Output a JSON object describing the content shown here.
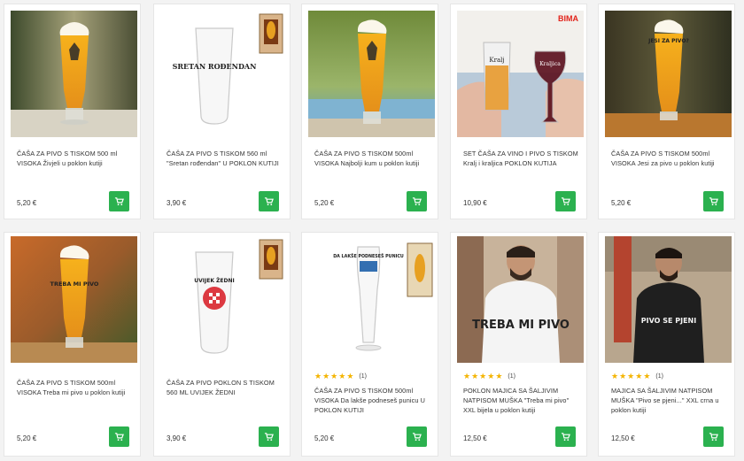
{
  "colors": {
    "accent": "#2bb14f",
    "star": "#f4b400",
    "price": "#333333"
  },
  "products": [
    {
      "title": "ČAŠA ZA PIVO S TISKOM 500 ml VISOKA Živjeli u poklon kutiji",
      "price": "5,20 €"
    },
    {
      "title": "ČAŠA ZA PIVO S TISKOM 560 ml \"Sretan rođendan\" U POKLON KUTIJI",
      "price": "3,90 €",
      "glass_print": "SRETAN ROĐENDAN"
    },
    {
      "title": "ČAŠA ZA PIVO S TISKOM 500ml VISOKA Najbolji kum u poklon kutiji",
      "price": "5,20 €"
    },
    {
      "title": "SET ČAŠA ZA VINO I PIVO S TISKOM Kralj i kraljica POKLON KUTIJA",
      "price": "10,90 €",
      "brand": "BIMA",
      "glass_left": "Kralj",
      "glass_right": "Kraljica"
    },
    {
      "title": "ČAŠA ZA PIVO S TISKOM 500ml VISOKA Jesi za pivo u poklon kutiji",
      "price": "5,20 €",
      "glass_print": "JESI ZA PIVO?"
    },
    {
      "title": "ČAŠA ZA PIVO S TISKOM 500ml VISOKA Treba mi pivo u poklon kutiji",
      "price": "5,20 €",
      "glass_print": "TREBA MI PIVO"
    },
    {
      "title": "ČAŠA ZA PIVO POKLON S TISKOM 560 ML UVIJEK ŽEDNI",
      "price": "3,90 €",
      "glass_print": "UVIJEK ŽEDNI"
    },
    {
      "title": "ČAŠA ZA PIVO S TISKOM 500ml VISOKA Da lakše podneseš punicu U POKLON KUTIJI",
      "price": "5,20 €",
      "rating_count": "(1)",
      "stars": 5,
      "glass_print": "DA LAKŠE PODNESEŠ PUNICU"
    },
    {
      "title": "POKLON MAJICA SA ŠALJIVIM NATPISOM MUŠKA \"Treba mi pivo\" XXL bijela u poklon kutiji",
      "price": "12,50 €",
      "rating_count": "(1)",
      "stars": 5,
      "shirt_print": "TREBA MI PIVO"
    },
    {
      "title": "MAJICA SA ŠALJIVIM NATPISOM MUŠKA \"Pivo se pjeni...\" XXL crna u poklon kutiji",
      "price": "12,50 €",
      "rating_count": "(1)",
      "stars": 5,
      "shirt_print": "PIVO SE PJENI"
    }
  ]
}
